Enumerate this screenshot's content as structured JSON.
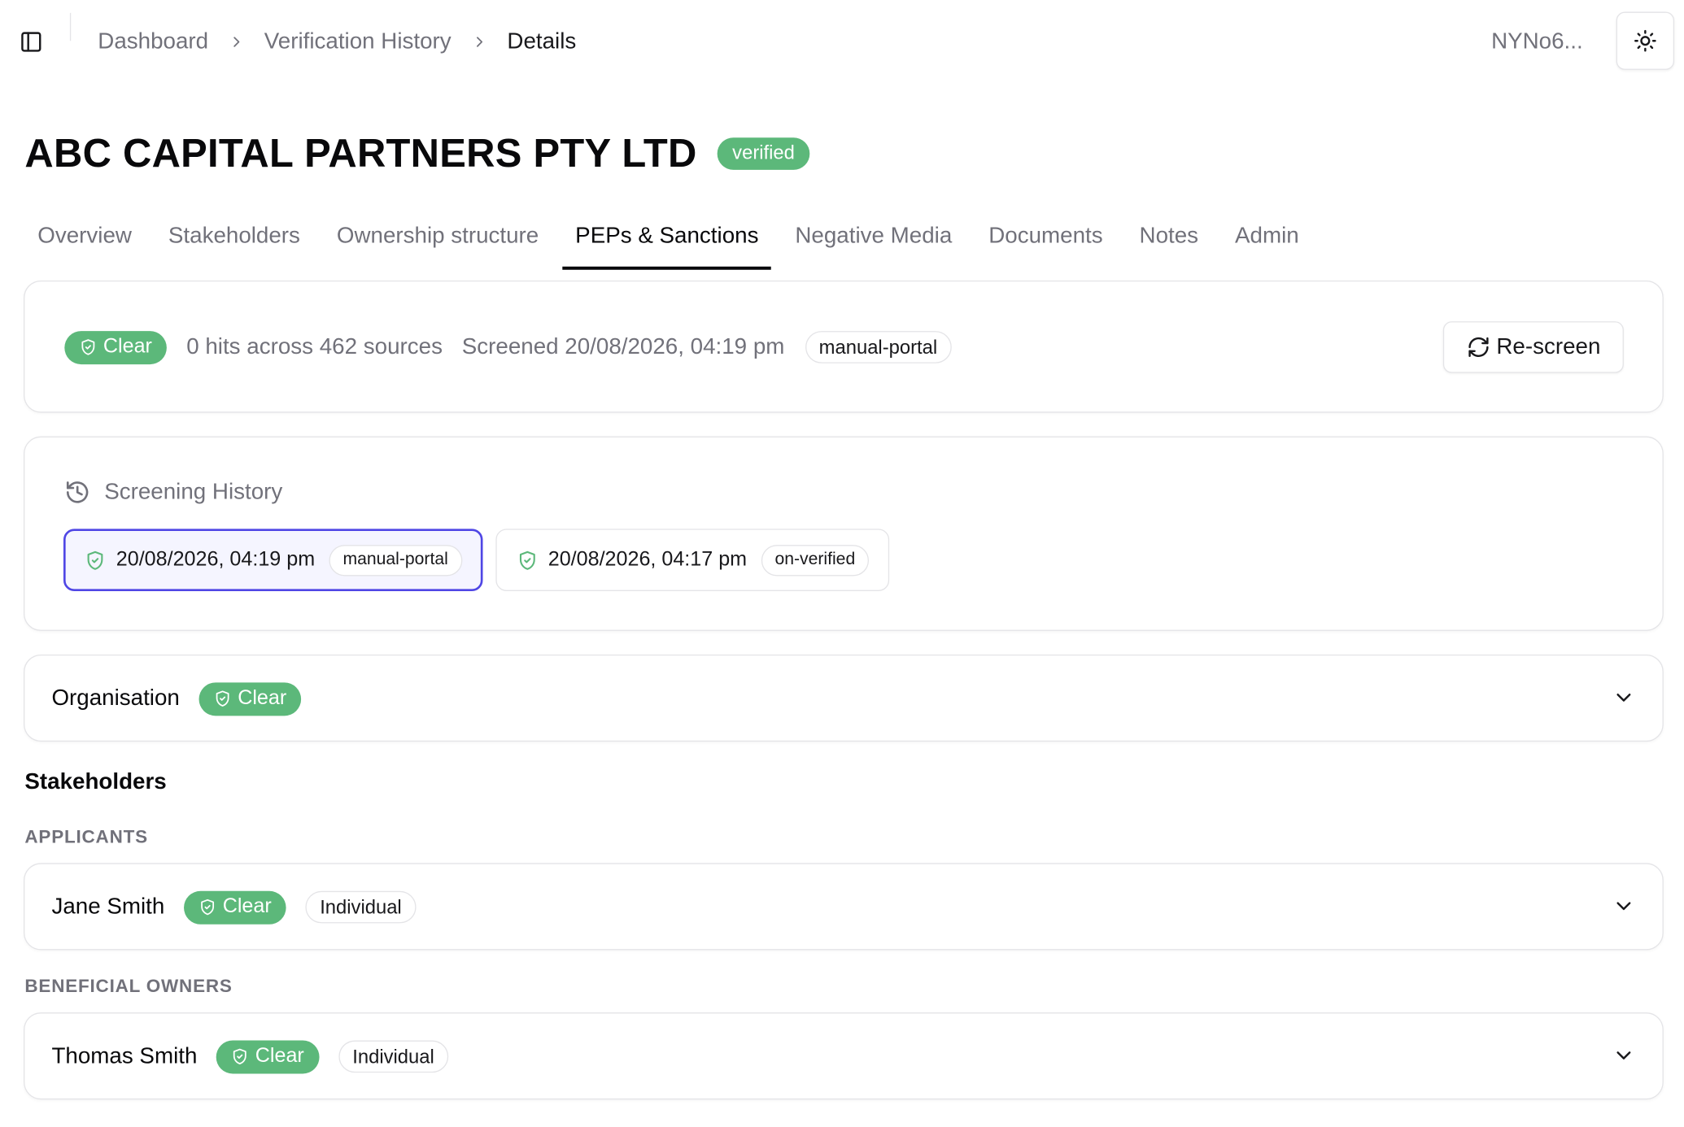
{
  "header": {
    "breadcrumb": [
      "Dashboard",
      "Verification History",
      "Details"
    ],
    "user_id": "NYNo6..."
  },
  "page": {
    "title": "ABC CAPITAL PARTNERS PTY LTD",
    "status": "verified"
  },
  "tabs": [
    {
      "label": "Overview",
      "active": false
    },
    {
      "label": "Stakeholders",
      "active": false
    },
    {
      "label": "Ownership structure",
      "active": false
    },
    {
      "label": "PEPs & Sanctions",
      "active": true
    },
    {
      "label": "Negative Media",
      "active": false
    },
    {
      "label": "Documents",
      "active": false
    },
    {
      "label": "Notes",
      "active": false
    },
    {
      "label": "Admin",
      "active": false
    }
  ],
  "summary": {
    "result": "Clear",
    "hits_text": "0 hits across 462 sources",
    "screened_text": "Screened 20/08/2026, 04:19 pm",
    "source_tag": "manual-portal",
    "rescreen_label": "Re-screen"
  },
  "history": {
    "heading": "Screening History",
    "items": [
      {
        "datetime": "20/08/2026, 04:19 pm",
        "tag": "manual-portal",
        "selected": true
      },
      {
        "datetime": "20/08/2026, 04:17 pm",
        "tag": "on-verified",
        "selected": false
      }
    ]
  },
  "organisation": {
    "label": "Organisation",
    "result": "Clear"
  },
  "stakeholders": {
    "heading": "Stakeholders",
    "applicants_label": "APPLICANTS",
    "owners_label": "BENEFICIAL OWNERS",
    "applicants": [
      {
        "name": "Jane Smith",
        "result": "Clear",
        "type": "Individual"
      }
    ],
    "owners": [
      {
        "name": "Thomas Smith",
        "result": "Clear",
        "type": "Individual"
      }
    ]
  },
  "colors": {
    "clear_green": "#5cb87a",
    "selected_border": "#4f46e5",
    "muted_text": "#71717a"
  },
  "icons": [
    "sidebar-toggle-icon",
    "chevron-right-icon",
    "sun-icon",
    "shield-check-icon",
    "refresh-icon",
    "history-icon",
    "chevron-down-icon"
  ]
}
